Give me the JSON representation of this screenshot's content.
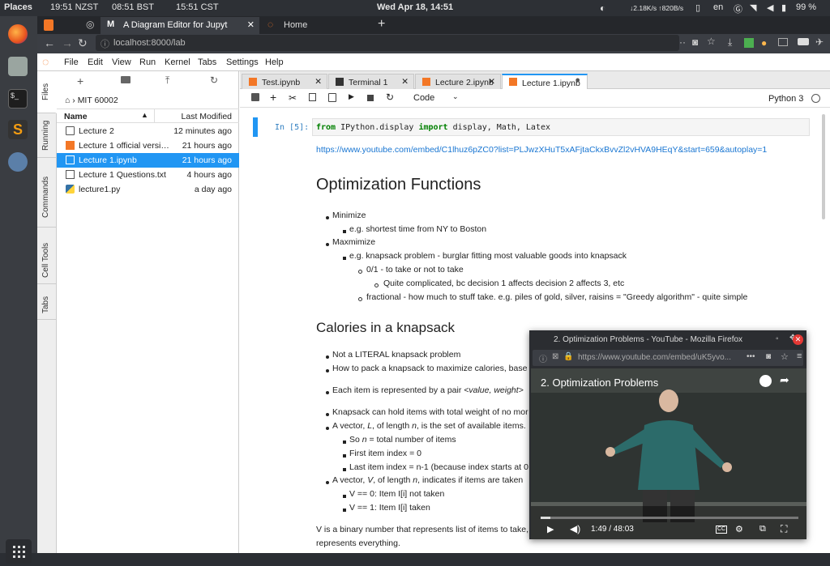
{
  "system": {
    "places": "Places",
    "clocks": [
      "19:51 NZST",
      "08:51 BST",
      "15:51 CST"
    ],
    "datetime": "Wed Apr 18, 14:51",
    "network": "↓2.18K/s ↑820B/s",
    "lang": "en",
    "battery": "99 %"
  },
  "browser": {
    "tabs": [
      {
        "label": ""
      },
      {
        "label": "A Diagram Editor for Jupyt"
      },
      {
        "label": "Home"
      }
    ],
    "new_tab": "+",
    "url": "localhost:8000/lab"
  },
  "menubar": [
    "File",
    "Edit",
    "View",
    "Run",
    "Kernel",
    "Tabs",
    "Settings",
    "Help"
  ],
  "left_tabs": [
    "Files",
    "Running",
    "Commands",
    "Cell Tools",
    "Tabs"
  ],
  "filebrowser": {
    "breadcrumb": "MIT 60002",
    "col_name": "Name",
    "col_modified": "Last Modified",
    "files": [
      {
        "name": "Lecture 2",
        "time": "12 minutes ago",
        "type": "folder"
      },
      {
        "name": "Lecture 1 official versio...",
        "time": "21 hours ago",
        "type": "notebook"
      },
      {
        "name": "Lecture 1.ipynb",
        "time": "21 hours ago",
        "type": "notebook",
        "selected": true
      },
      {
        "name": "Lecture 1 Questions.txt",
        "time": "4 hours ago",
        "type": "text"
      },
      {
        "name": "lecture1.py",
        "time": "a day ago",
        "type": "python"
      }
    ]
  },
  "doc_tabs": [
    {
      "label": "Test.ipynb"
    },
    {
      "label": "Terminal 1"
    },
    {
      "label": "Lecture 2.ipynb"
    },
    {
      "label": "Lecture 1.ipynb",
      "active": true
    }
  ],
  "toolbar": {
    "cell_type": "Code",
    "kernel": "Python 3"
  },
  "notebook": {
    "prompt": "In [5]:",
    "code_from": "from",
    "code_module": " IPython.display ",
    "code_import": "import",
    "code_names": " display, Math, Latex",
    "link": "https://www.youtube.com/embed/C1lhuz6pZC0?list=PLJwzXHuT5xAFjtaCkxBvvZl2vHVA9HEqY&start=659&autoplay=1",
    "h1": "Optimization Functions",
    "opt_items": [
      "Minimize",
      "e.g. shortest time from NY to Boston",
      "Maxmimize",
      "e.g. knapsack problem - burglar fitting most valuable goods into knapsack",
      "0/1 - to take or not to take",
      "Quite complicated, bc decision 1 affects decision 2 affects 3, etc",
      "fractional - how much to stuff take. e.g. piles of gold, silver, raisins = \"Greedy algorithm\" - quite simple"
    ],
    "h2": "Calories in a knapsack",
    "cal_items": [
      "Not a LITERAL knapsack problem",
      "How to pack a knapsack to maximize calories, base",
      "Each item is represented by a pair ",
      "<value, weight>",
      "Knapsack can hold items with total weight of no mor",
      "A vector, ",
      "L",
      ", of length ",
      "n",
      ", is the set of available items.",
      "So ",
      "n",
      " = total number of items",
      "First item index = 0",
      "Last item index = n-1 (because index starts at 0",
      "A vector, ",
      "V",
      ", of length ",
      "n",
      ", indicates if items are taken",
      "V == 0: Item I[i] not taken",
      "V == 1: Item I[i] taken"
    ],
    "para1": "V is a binary number that represents list of items to take,",
    "para2": "represents everything."
  },
  "popup": {
    "title": "2. Optimization Problems - YouTube - Mozilla Firefox",
    "url": "https://www.youtube.com/embed/uK5yvo...",
    "video_title": "2. Optimization Problems",
    "time": "1:49 / 48:03",
    "progress": 0.038
  },
  "colors": {
    "accent": "#2196f3",
    "code_kw": "#008000"
  }
}
